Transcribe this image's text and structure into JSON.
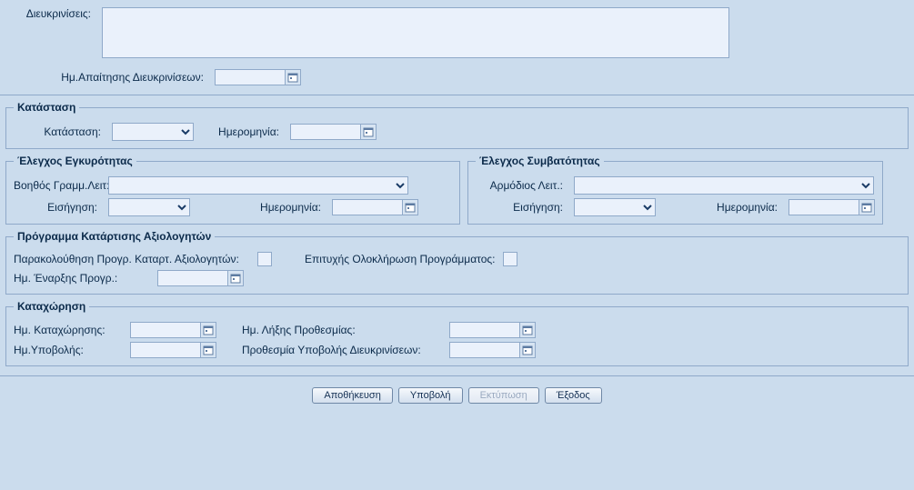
{
  "clarifications": {
    "label": "Διευκρινίσεις:",
    "value": "",
    "request_date_label": "Ημ.Απαίτησης Διευκρινίσεων:",
    "request_date": ""
  },
  "status": {
    "legend": "Κατάσταση",
    "status_label": "Κατάσταση:",
    "status_value": "",
    "date_label": "Ημερομηνία:",
    "date_value": ""
  },
  "validity": {
    "legend": "Έλεγχος Εγκυρότητας",
    "assistant_label": "Βοηθός Γραμμ.Λειτ:",
    "assistant_value": "",
    "recommendation_label": "Εισήγηση:",
    "recommendation_value": "",
    "date_label": "Ημερομηνία:",
    "date_value": ""
  },
  "compatibility": {
    "legend": "Έλεγχος Συμβατότητας",
    "officer_label": "Αρμόδιος Λειτ.:",
    "officer_value": "",
    "recommendation_label": "Εισήγηση:",
    "recommendation_value": "",
    "date_label": "Ημερομηνία:",
    "date_value": ""
  },
  "training": {
    "legend": "Πρόγραμμα Κατάρτισης Αξιολογητών",
    "attend_label": "Παρακολούθηση Προγρ. Καταρτ. Αξιολογητών:",
    "success_label": "Επιτυχής Ολοκλήρωση Προγράμματος:",
    "start_label": "Ημ. Έναρξης Προγρ.:",
    "start_value": ""
  },
  "registration": {
    "legend": "Καταχώρηση",
    "reg_date_label": "Ημ. Καταχώρησης:",
    "reg_date": "",
    "submit_date_label": "Ημ.Υποβολής:",
    "submit_date": "",
    "deadline_label": "Ημ. Λήξης Προθεσμίας:",
    "deadline_date": "",
    "clar_deadline_label": "Προθεσμία Υποβολής Διευκρινίσεων:",
    "clar_deadline_date": ""
  },
  "buttons": {
    "save": "Αποθήκευση",
    "submit": "Υποβολή",
    "print": "Εκτύπωση",
    "exit": "Έξοδος"
  }
}
